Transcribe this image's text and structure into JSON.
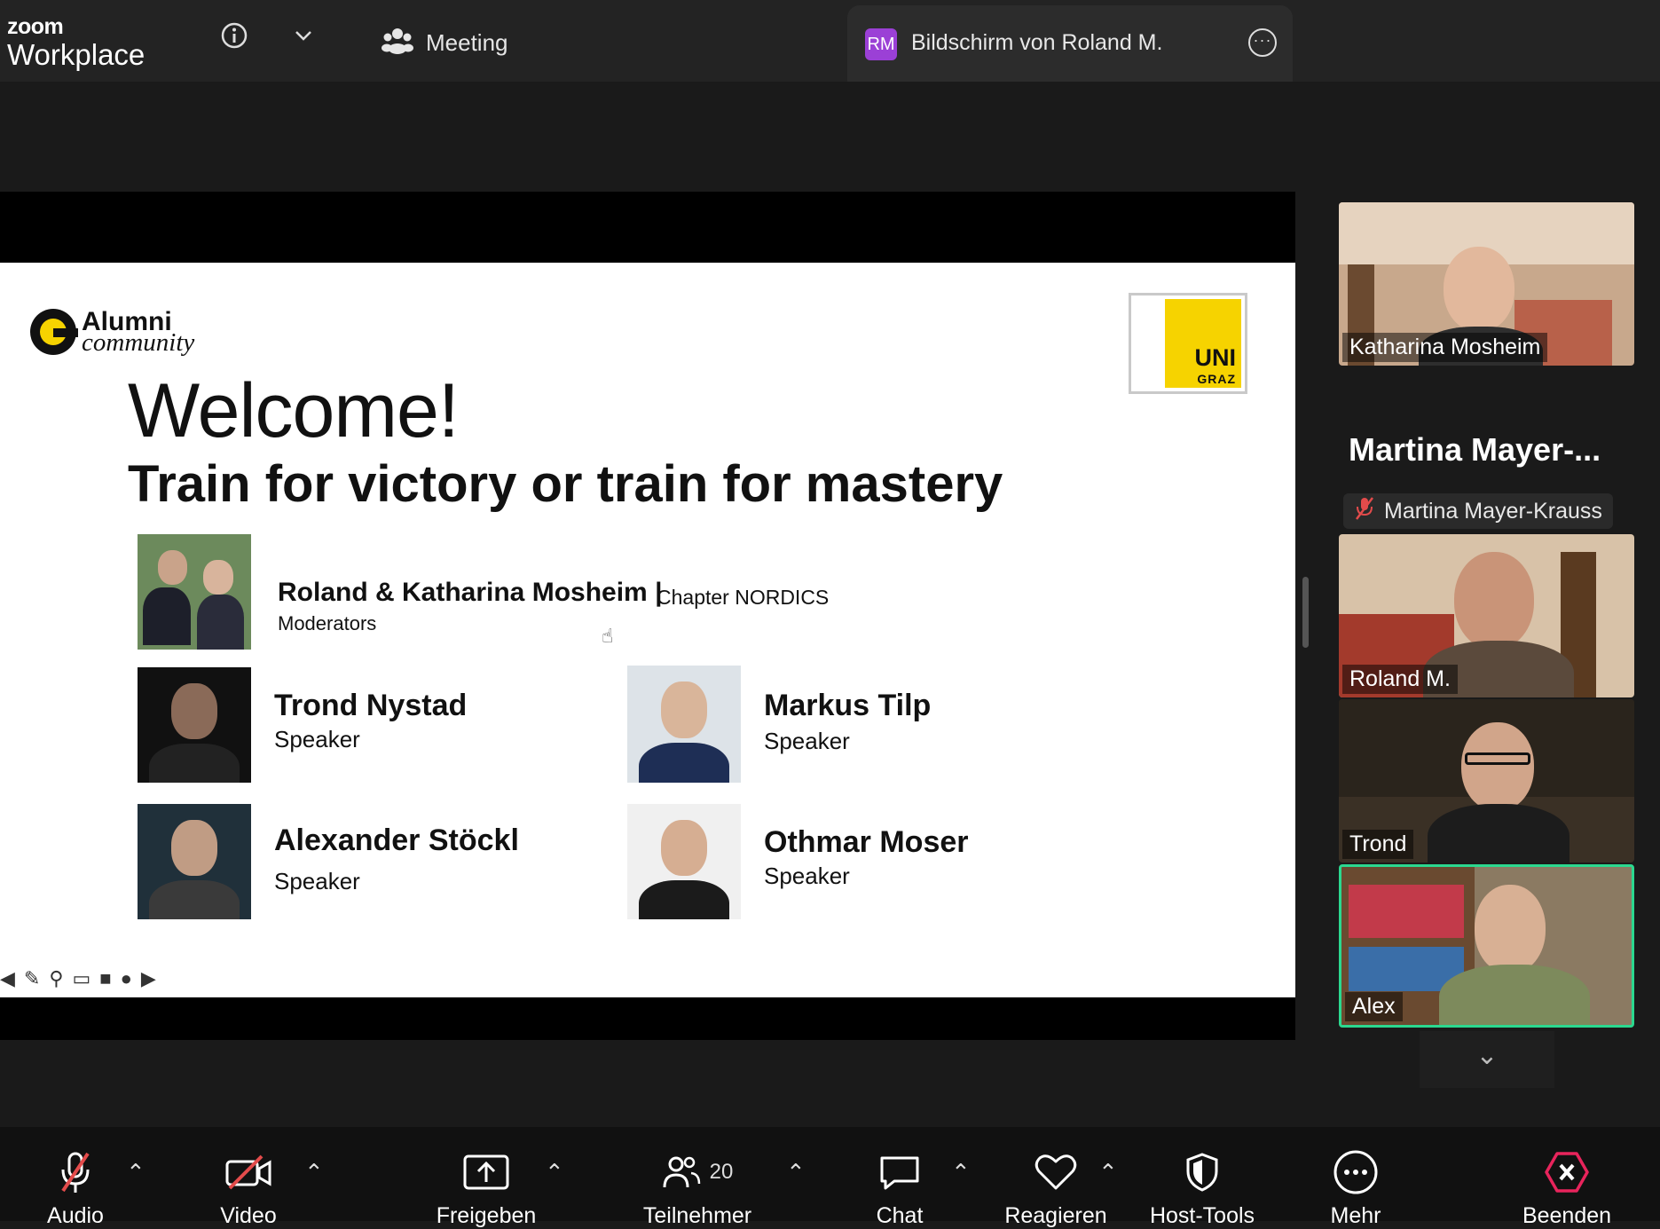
{
  "app": {
    "brand_small": "zoom",
    "brand_large": "Workplace"
  },
  "topbar": {
    "info_icon": "info-icon",
    "meeting_label": "Meeting",
    "share_tab": {
      "badge": "RM",
      "title": "Bildschirm von Roland M.",
      "more_icon": "more-icon"
    }
  },
  "slide": {
    "logo_line1": "Alumni",
    "logo_line2": "community",
    "uni_logo_top": "UNI",
    "uni_logo_bottom": "GRAZ",
    "welcome": "Welcome!",
    "subtitle": "Train for victory or train for mastery",
    "moderators": {
      "name": "Roland & Katharina Mosheim",
      "separator": "|",
      "chapter": "Chapter NORDICS",
      "role": "Moderators"
    },
    "speakers": [
      {
        "name": "Trond Nystad",
        "role": "Speaker"
      },
      {
        "name": "Markus Tilp",
        "role": "Speaker"
      },
      {
        "name": "Alexander Stöckl",
        "role": "Speaker"
      },
      {
        "name": "Othmar Moser",
        "role": "Speaker"
      }
    ]
  },
  "participants": {
    "tiles": [
      {
        "name": "Katharina Mosheim"
      },
      {
        "name": "Roland M."
      },
      {
        "name": "Trond"
      },
      {
        "name": "Alex"
      }
    ],
    "audio_only_label": "Martina  Mayer-...",
    "audio_only_full": "Martina Mayer-Krauss",
    "active_speaker_color": "#2bd88f"
  },
  "toolbar": {
    "audio": "Audio",
    "video": "Video",
    "share": "Freigeben",
    "participants": "Teilnehmer",
    "participants_count": "20",
    "chat": "Chat",
    "react": "Reagieren",
    "host_tools": "Host-Tools",
    "more": "Mehr",
    "end": "Beenden",
    "end_color": "#e8245c"
  }
}
